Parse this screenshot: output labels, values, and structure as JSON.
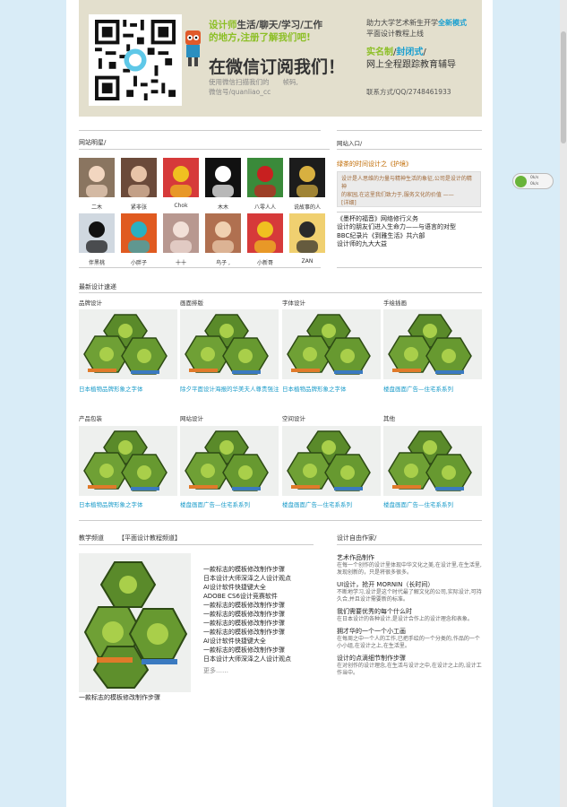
{
  "banner": {
    "tagline_part1": "设计师",
    "tagline_part2": "生活/聊天/学习/工作",
    "tagline_part3": "的地方,注册了解我们吧!",
    "subscribe": "在微信订阅我们！",
    "small_line1": "使用微信扫描我们的　　帧码,",
    "small_line2": "微信号/quanliao_cc",
    "right_line1a": "助力大学艺术新生开学",
    "right_line1b": "全新模式",
    "right_line2": "平面设计教程上线",
    "right_l3a": "实名制",
    "right_l3b": "/",
    "right_l3c": "封闭式",
    "right_l3d": "/",
    "right_l4": "网上全程跟踪教育辅导",
    "contact": "联系方式/QQ/2748461933"
  },
  "users": {
    "title": "网站明星/",
    "names_row1": [
      "二木",
      "紧非张",
      "Chok",
      "木木",
      "八零人人",
      "说故事的人"
    ],
    "names_row2": [
      "伴黑桃",
      "小胖子",
      "十十",
      "鸟子 ,",
      "小新哥",
      "ZAN"
    ]
  },
  "news": {
    "title": "网站入口/",
    "headline": "绿茶的时间设计之《护境》",
    "box_line1": "设计是人思维的力量与精神生活的象征,公司是设计的精神",
    "box_line2": "的家园,在这里我们致力于,服务文化的价值 ——",
    "box_line3": "[详细]",
    "items": [
      "《墨杯的福音》网络修行义务",
      "设计的朋友们进入生命力——与语言的对型",
      "BBC纪录片《到雅生活》共六部",
      "设计师的九大大益"
    ]
  },
  "latest": {
    "title": "最新设计速递",
    "row1": [
      {
        "cat": "品牌设计",
        "cap": "日本植物品牌形象之字体"
      },
      {
        "cat": "画面排版",
        "cap": "除夕平面设计海报的华美夫人尊贵强注"
      },
      {
        "cat": "字体设计",
        "cap": "日本植物品牌形象之字体"
      },
      {
        "cat": "手绘插画",
        "cap": "楼盘画面广告—住宅系系列"
      }
    ],
    "row2": [
      {
        "cat": "产品包装",
        "cap": "日本植物品牌形象之字体"
      },
      {
        "cat": "网站设计",
        "cap": "楼盘画面广告—住宅系系列"
      },
      {
        "cat": "空间设计",
        "cap": "楼盘画面广告—住宅系系列"
      },
      {
        "cat": "其他",
        "cap": "楼盘画面广告—住宅系系列"
      }
    ]
  },
  "video": {
    "title": "教学频道",
    "tag": "【平面设计教程频道】",
    "caption": "一款标志的模板修改制作步骤",
    "items": [
      "一款标志的模板修改制作步骤",
      "日本设计大师深泽之人设计观点",
      "AI设计软件快捷键大全",
      "ADOBE CS6设计竞赛软件",
      "一款标志的模板修改制作步骤",
      "一款标志的模板修改制作步骤",
      "一款标志的模板修改制作步骤",
      "一款标志的模板修改制作步骤",
      "AI设计软件快捷键大全",
      "一款标志的模板修改制作步骤",
      "日本设计大师深泽之人设计观点"
    ],
    "more": "更多……"
  },
  "articles": {
    "title": "设计自由作家/",
    "items": [
      {
        "t": "艺术作品制作",
        "d": "在每一个创作的设计里体现中华文化之美,在设计里,在生活里,发现创新的，只是将很多很多。"
      },
      {
        "t": "UI设计，抢开 MORNIN（长时间）",
        "d": "不断地学习,设计是这个时代最了解文化的公司,实际设计,可持久合,并且设计需要新的标准。"
      },
      {
        "t": "我们需要优秀的每个什么时",
        "d": "在日本设计的各种设计,是设计合作上的设计理念和表象。"
      },
      {
        "t": "拥才华的一个一个小工画",
        "d": "在每周之中一个人的工作,已把手绘的一个分类的,作品的一个小小组,在设计之上,在生活里。"
      },
      {
        "t": "设计的点滴细节制作步骤",
        "d": "在对创作的设计理念,在生活与设计之中,在设计之上的,设计工作当中。"
      }
    ]
  },
  "widget": {
    "line1": "0k/s",
    "line2": "0k/s"
  }
}
